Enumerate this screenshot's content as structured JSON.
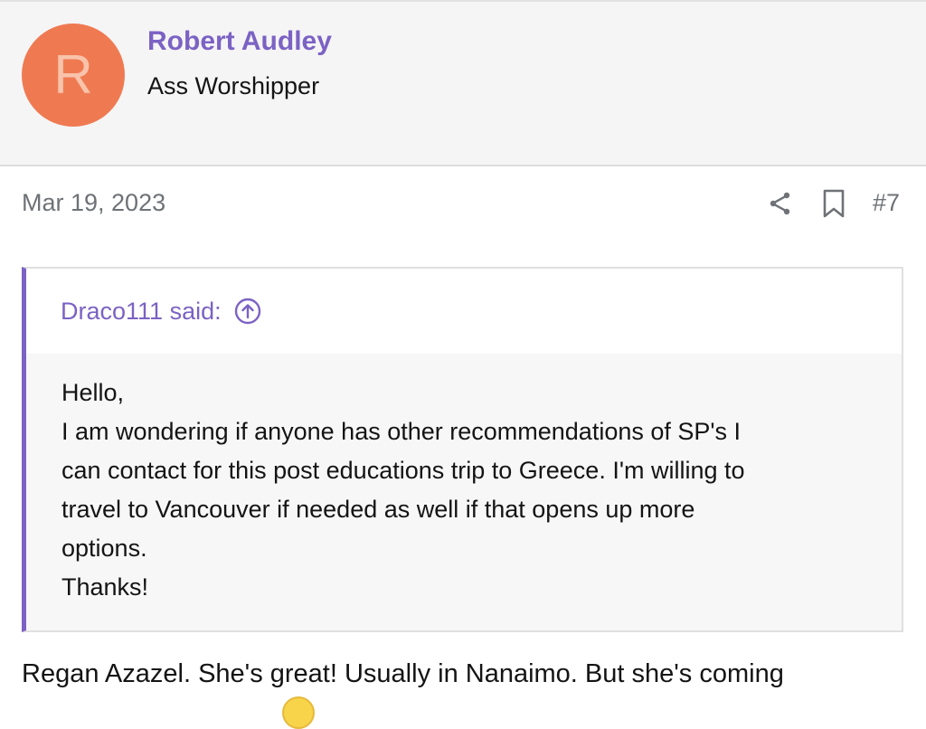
{
  "user": {
    "avatar_letter": "R",
    "avatar_color": "#ef7a52",
    "name": "Robert Audley",
    "title": "Ass Worshipper"
  },
  "post": {
    "date": "Mar 19, 2023",
    "number": "#7",
    "share_icon": "share-icon",
    "bookmark_icon": "bookmark-icon"
  },
  "quote": {
    "attribution": "Draco111 said:",
    "jump_icon": "arrow-up-circle-icon",
    "lines": [
      "Hello,",
      "I am wondering if anyone has other recommendations of SP's I",
      "can contact for this post educations trip to Greece. I'm willing to",
      "travel to Vancouver if needed as well if that opens up more",
      "options.",
      "Thanks!"
    ]
  },
  "reply": {
    "text": "Regan Azazel. She's great! Usually in Nanaimo. But she's coming"
  },
  "colors": {
    "accent": "#7b62c4",
    "header_bg": "#f5f5f5",
    "muted_text": "#6e7276"
  }
}
